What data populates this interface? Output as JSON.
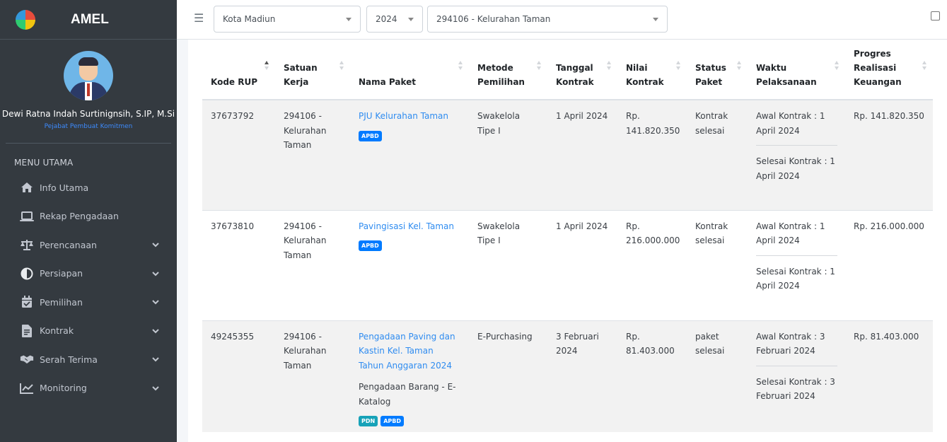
{
  "brand": {
    "name": "AMEL"
  },
  "user": {
    "name": "Dewi Ratna Indah Surtinignsih, S.IP, M.Si",
    "role": "Pejabat Pembuat Komitmen"
  },
  "menu": {
    "header": "MENU UTAMA",
    "items": [
      {
        "label": "Info Utama",
        "icon": "home-icon"
      },
      {
        "label": "Rekap Pengadaan",
        "icon": "laptop-icon"
      },
      {
        "label": "Perencanaan",
        "icon": "balance-scale-icon"
      },
      {
        "label": "Persiapan",
        "icon": "adjust-icon"
      },
      {
        "label": "Pemilihan",
        "icon": "calendar-check-icon"
      },
      {
        "label": "Kontrak",
        "icon": "file-contract-icon"
      },
      {
        "label": "Serah Terima",
        "icon": "handshake-icon"
      },
      {
        "label": "Monitoring",
        "icon": "chart-line-icon"
      }
    ]
  },
  "filters": {
    "kota": "Kota Madiun",
    "tahun": "2024",
    "satker": "294106 - Kelurahan Taman"
  },
  "table": {
    "headers": [
      "Kode RUP",
      "Satuan Kerja",
      "Nama Paket",
      "Metode Pemilihan",
      "Tanggal Kontrak",
      "Nilai Kontrak",
      "Status Paket",
      "Waktu Pelaksanaan",
      "Progres Realisasi Keuangan"
    ],
    "rows": [
      {
        "kode": "37673792",
        "satker": "294106 - Kelurahan Taman",
        "nama": "PJU Kelurahan Taman",
        "sub": "",
        "badges": [
          "APBD"
        ],
        "metode": "Swakelola Tipe I",
        "tanggal": "1 April 2024",
        "nilai": "Rp. 141.820.350",
        "status": "Kontrak selesai",
        "awal": "Awal Kontrak : 1 April 2024",
        "selesai": "Selesai Kontrak : 1 April 2024",
        "progres": "Rp. 141.820.350"
      },
      {
        "kode": "37673810",
        "satker": "294106 - Kelurahan Taman",
        "nama": "Pavingisasi Kel. Taman",
        "sub": "",
        "badges": [
          "APBD"
        ],
        "metode": "Swakelola Tipe I",
        "tanggal": "1 April 2024",
        "nilai": "Rp. 216.000.000",
        "status": "Kontrak selesai",
        "awal": "Awal Kontrak : 1 April 2024",
        "selesai": "Selesai Kontrak : 1 April 2024",
        "progres": "Rp. 216.000.000"
      },
      {
        "kode": "49245355",
        "satker": "294106 - Kelurahan Taman",
        "nama": "Pengadaan Paving dan Kastin Kel. Taman Tahun Anggaran 2024",
        "sub": "Pengadaan Barang - E-Katalog",
        "badges": [
          "PDN",
          "APBD"
        ],
        "metode": "E-Purchasing",
        "tanggal": "3 Februari 2024",
        "nilai": "Rp. 81.403.000",
        "status": "paket selesai",
        "awal": "Awal Kontrak : 3 Februari 2024",
        "selesai": "Selesai Kontrak : 3 Februari 2024",
        "progres": "Rp. 81.403.000"
      }
    ]
  },
  "colors": {
    "sidebar_bg": "#343a40",
    "link": "#2f8cf0",
    "badge_apbd": "#007bff",
    "badge_pdn": "#17a2b8"
  }
}
